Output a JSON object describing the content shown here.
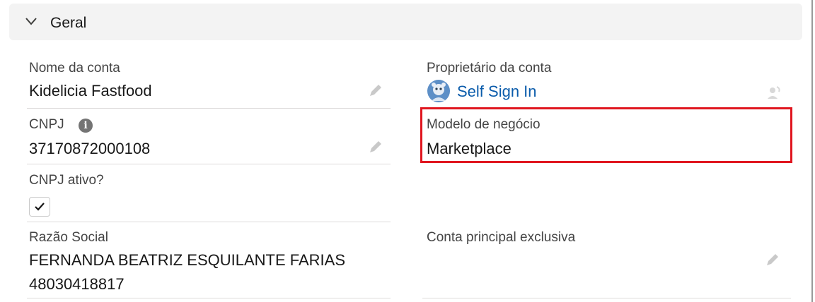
{
  "section": {
    "title": "Geral"
  },
  "fields": {
    "account_name": {
      "label": "Nome da conta",
      "value": "Kidelicia Fastfood"
    },
    "account_owner": {
      "label": "Proprietário da conta",
      "value": "Self Sign In"
    },
    "cnpj": {
      "label": "CNPJ",
      "value": "37170872000108"
    },
    "business_model": {
      "label": "Modelo de negócio",
      "value": "Marketplace"
    },
    "cnpj_active": {
      "label": "CNPJ ativo?",
      "checked": true
    },
    "company_name": {
      "label": "Razão Social",
      "value_line1": "FERNANDA BEATRIZ ESQUILANTE FARIAS",
      "value_line2": "48030418817"
    },
    "exclusive_parent": {
      "label": "Conta principal exclusiva",
      "value": ""
    }
  },
  "icons": {
    "section_toggle": "chevron-down-icon",
    "edit": "pencil-icon",
    "info": "info-icon",
    "avatar": "avatar-icon",
    "change_owner": "change-owner-icon",
    "checkmark": "checkmark-icon"
  },
  "colors": {
    "link": "#0b5cab",
    "highlight": "#e0161f",
    "section_bg": "#f3f3f3"
  }
}
